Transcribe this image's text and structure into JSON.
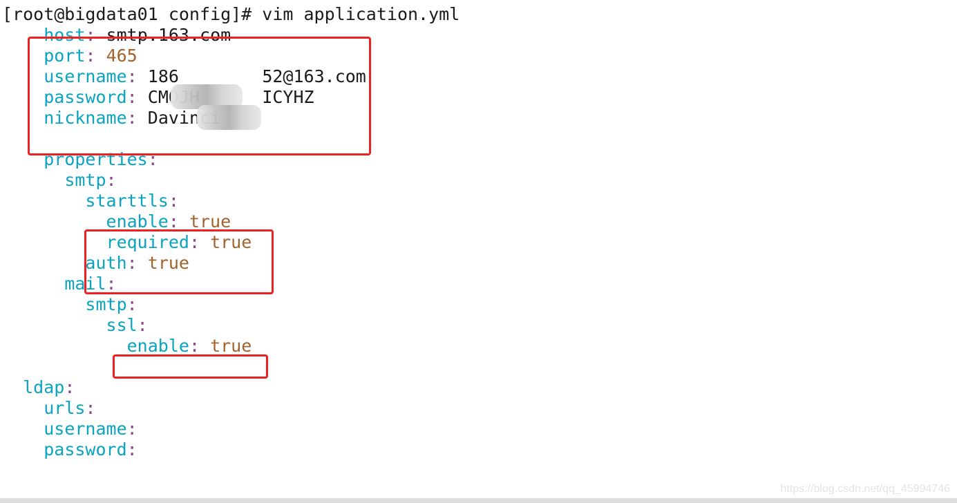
{
  "prompt": "[root@bigdata01 config]# vim application.yml",
  "lines": [
    {
      "indent": 4,
      "key": "host",
      "value": "smtp.163.com",
      "type": "str"
    },
    {
      "indent": 4,
      "key": "port",
      "value": "465",
      "type": "num"
    },
    {
      "indent": 4,
      "key": "username",
      "value": "186        52@163.com",
      "type": "str"
    },
    {
      "indent": 4,
      "key": "password",
      "value": "CMOJH      ICYHZ",
      "type": "str"
    },
    {
      "indent": 4,
      "key": "nickname",
      "value": "Davinci",
      "type": "str"
    },
    {
      "indent": 0,
      "key": "",
      "value": "",
      "type": "blank"
    },
    {
      "indent": 4,
      "key": "properties",
      "value": "",
      "type": "none"
    },
    {
      "indent": 6,
      "key": "smtp",
      "value": "",
      "type": "none"
    },
    {
      "indent": 8,
      "key": "starttls",
      "value": "",
      "type": "none"
    },
    {
      "indent": 10,
      "key": "enable",
      "value": "true",
      "type": "bool"
    },
    {
      "indent": 10,
      "key": "required",
      "value": "true",
      "type": "bool"
    },
    {
      "indent": 8,
      "key": "auth",
      "value": "true",
      "type": "bool"
    },
    {
      "indent": 6,
      "key": "mail",
      "value": "",
      "type": "none"
    },
    {
      "indent": 8,
      "key": "smtp",
      "value": "",
      "type": "none"
    },
    {
      "indent": 10,
      "key": "ssl",
      "value": "",
      "type": "none"
    },
    {
      "indent": 12,
      "key": "enable",
      "value": "true",
      "type": "bool"
    },
    {
      "indent": 0,
      "key": "",
      "value": "",
      "type": "blank"
    },
    {
      "indent": 2,
      "key": "ldap",
      "value": "",
      "type": "none"
    },
    {
      "indent": 4,
      "key": "urls",
      "value": "",
      "type": "none"
    },
    {
      "indent": 4,
      "key": "username",
      "value": "",
      "type": "none"
    },
    {
      "indent": 4,
      "key": "password",
      "value": "",
      "type": "none"
    }
  ],
  "colors": {
    "key": "#0aa3c2",
    "colon": "#8b3f8f",
    "literal": "#a4622b",
    "highlight_box": "#f02020"
  },
  "watermark": "https://blog.csdn.net/qq_45994746"
}
